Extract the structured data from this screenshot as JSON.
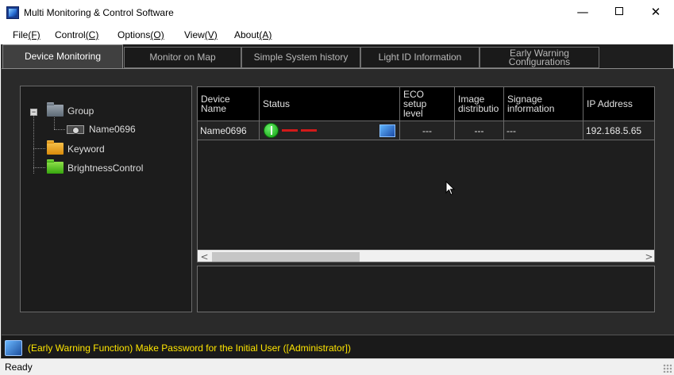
{
  "window": {
    "title": "Multi Monitoring & Control Software",
    "minimize": "—",
    "close": "✕"
  },
  "menu": [
    {
      "label": "File",
      "key": "(F)"
    },
    {
      "label": "Control",
      "key": "(C)"
    },
    {
      "label": "Options",
      "key": "(O)"
    },
    {
      "label": "View",
      "key": "(V)"
    },
    {
      "label": "About",
      "key": "(A)"
    }
  ],
  "tabs": [
    {
      "label": "Device Monitoring",
      "active": true
    },
    {
      "label": "Monitor on Map",
      "active": false
    },
    {
      "label": "Simple System history",
      "active": false
    },
    {
      "label": "Light ID Information",
      "active": false
    },
    {
      "label": "Early Warning\nConfigurations",
      "active": false
    }
  ],
  "tree": {
    "expander": "−",
    "group": "Group",
    "device": "Name0696",
    "keyword": "Keyword",
    "brightness": "BrightnessControl"
  },
  "grid": {
    "headers": [
      "Device\nName",
      "Status",
      "ECO\nsetup\nlevel",
      "Image\ndistributio",
      "Signage\ninformation",
      "IP Address"
    ],
    "rows": [
      {
        "device_name": "Name0696",
        "status": "ok",
        "eco": "---",
        "image": "---",
        "signage": "---",
        "ip": "192.168.5.65"
      }
    ],
    "scroll_left": "<",
    "scroll_right": ">"
  },
  "warning": {
    "text": "(Early Warning Function) Make Password for the Initial User ([Administrator])",
    "color": "#ffe600"
  },
  "statusbar": {
    "text": "Ready"
  },
  "colors": {
    "background_dark": "#2a2a2a",
    "status_ok": "#12b012",
    "status_red": "#d11a1a"
  }
}
